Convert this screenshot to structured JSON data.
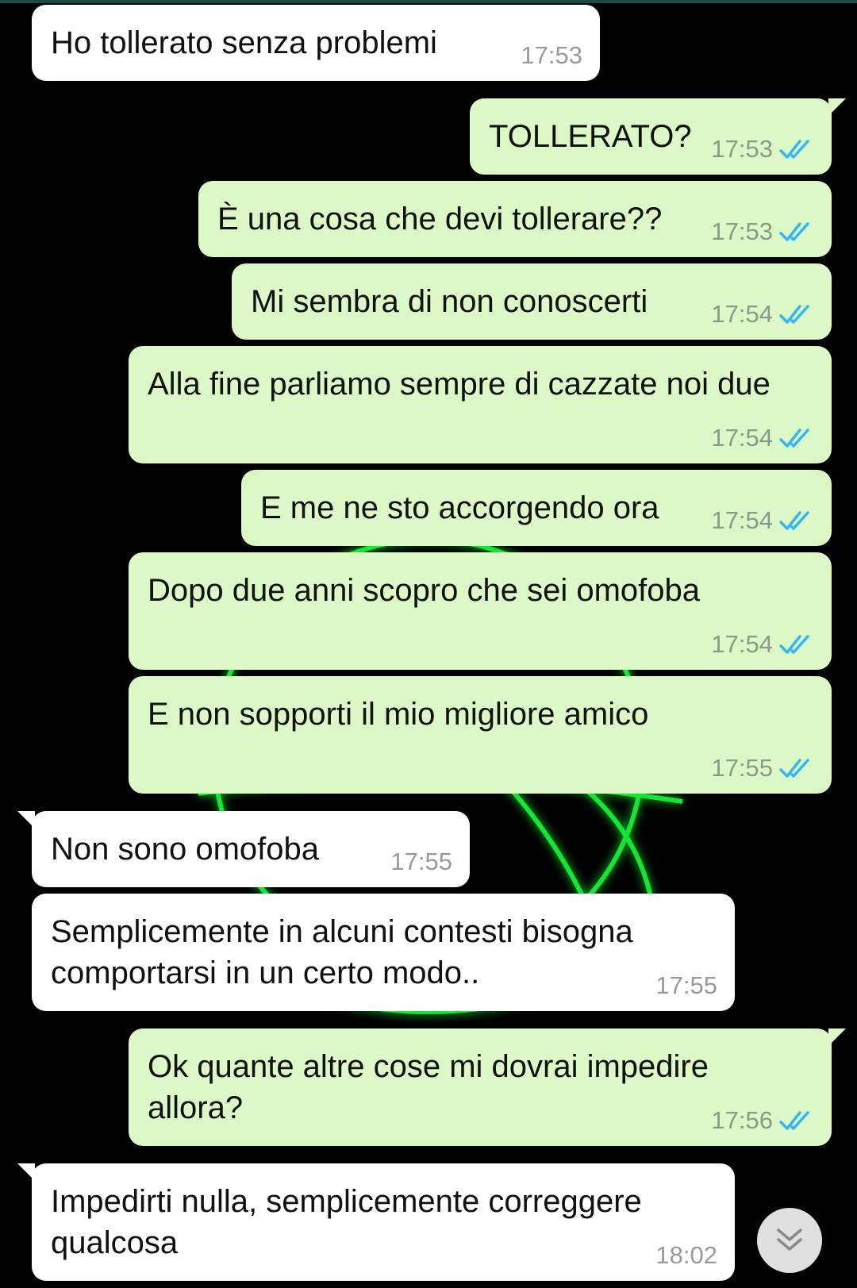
{
  "colors": {
    "incoming_bubble": "#ffffff",
    "outgoing_bubble": "#dcf8c6",
    "read_ticks": "#34b7f1",
    "wallpaper_glow": "#19ff3a",
    "background": "#000000"
  },
  "messages": [
    {
      "id": "m1",
      "direction": "incoming",
      "text": "Ho tollerato senza problemi",
      "time": "17:53"
    },
    {
      "id": "m2",
      "direction": "outgoing",
      "text": "TOLLERATO?",
      "time": "17:53",
      "status": "read"
    },
    {
      "id": "m3",
      "direction": "outgoing",
      "text": "È una cosa che devi tollerare??",
      "time": "17:53",
      "status": "read"
    },
    {
      "id": "m4",
      "direction": "outgoing",
      "text": "Mi sembra di non conoscerti",
      "time": "17:54",
      "status": "read"
    },
    {
      "id": "m5",
      "direction": "outgoing",
      "text": "Alla fine parliamo sempre di cazzate noi due",
      "time": "17:54",
      "status": "read"
    },
    {
      "id": "m6",
      "direction": "outgoing",
      "text": "E me ne sto accorgendo ora",
      "time": "17:54",
      "status": "read"
    },
    {
      "id": "m7",
      "direction": "outgoing",
      "text": "Dopo due anni scopro che sei omofoba",
      "time": "17:54",
      "status": "read"
    },
    {
      "id": "m8",
      "direction": "outgoing",
      "text": "E non sopporti il mio migliore amico",
      "time": "17:55",
      "status": "read"
    },
    {
      "id": "m9",
      "direction": "incoming",
      "text": "Non sono omofoba",
      "time": "17:55"
    },
    {
      "id": "m10",
      "direction": "incoming",
      "text": "Semplicemente in alcuni contesti bisogna comportarsi in un certo modo..",
      "time": "17:55"
    },
    {
      "id": "m11",
      "direction": "outgoing",
      "text": "Ok quante altre cose mi dovrai impedire allora?",
      "time": "17:56",
      "status": "read"
    },
    {
      "id": "m12",
      "direction": "incoming",
      "text": "Impedirti nulla, semplicemente correggere qualcosa",
      "time": "18:02"
    }
  ],
  "scroll_button": {
    "icon": "double-chevron-down-icon"
  }
}
